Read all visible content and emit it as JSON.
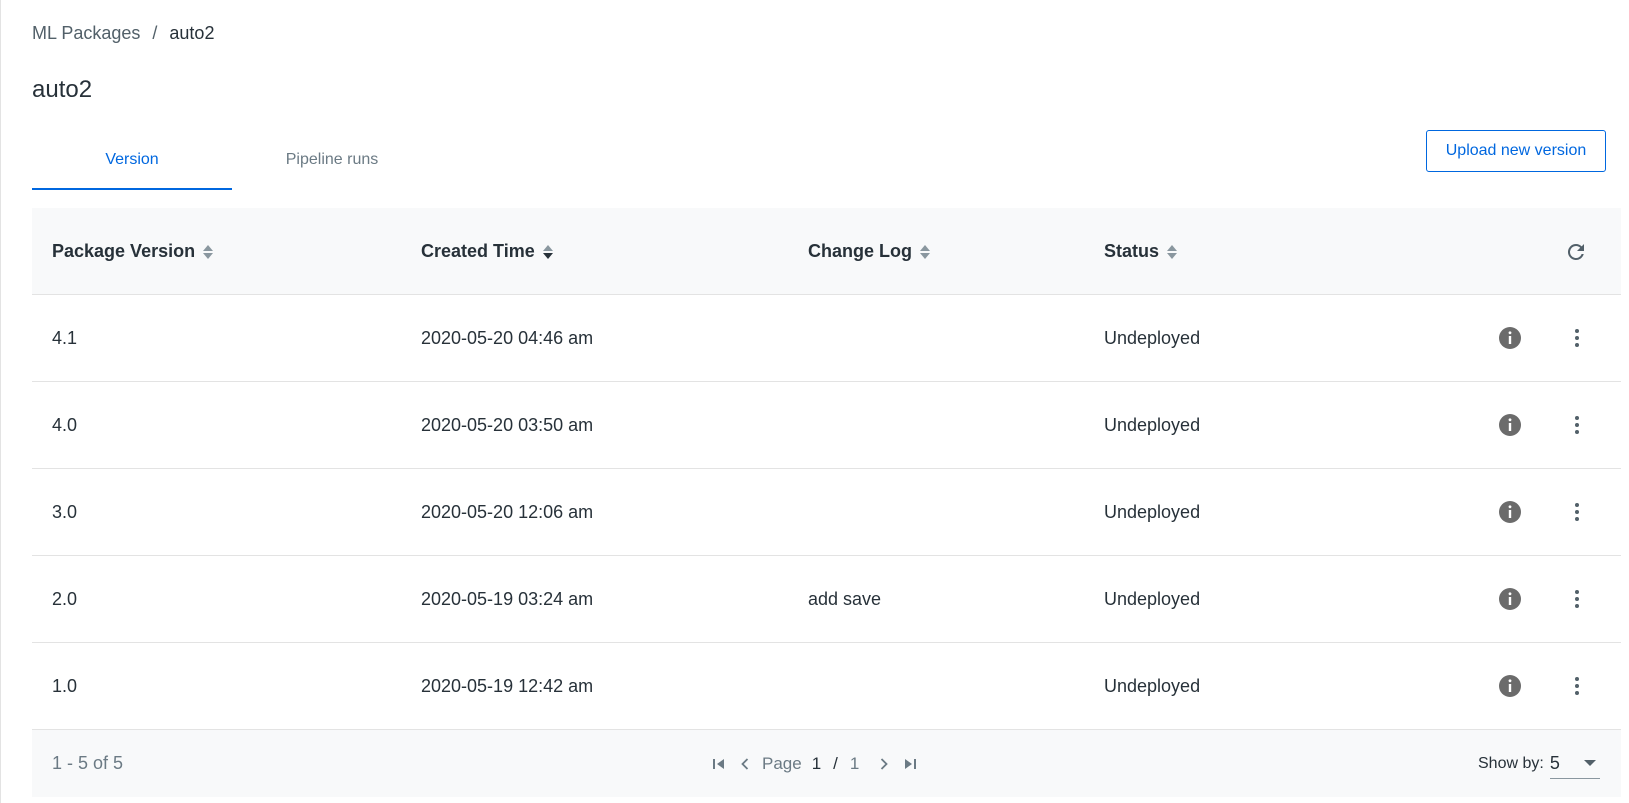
{
  "breadcrumb": {
    "parent": "ML Packages",
    "separator": "/",
    "current": "auto2"
  },
  "page_title": "auto2",
  "tabs": [
    {
      "label": "Version",
      "active": true
    },
    {
      "label": "Pipeline runs",
      "active": false
    }
  ],
  "upload_button": "Upload new version",
  "table": {
    "columns": [
      {
        "label": "Package Version"
      },
      {
        "label": "Created Time"
      },
      {
        "label": "Change Log"
      },
      {
        "label": "Status"
      }
    ],
    "rows": [
      {
        "version": "4.1",
        "created": "2020-05-20 04:46 am",
        "changelog": "",
        "status": "Undeployed"
      },
      {
        "version": "4.0",
        "created": "2020-05-20 03:50 am",
        "changelog": "",
        "status": "Undeployed"
      },
      {
        "version": "3.0",
        "created": "2020-05-20 12:06 am",
        "changelog": "",
        "status": "Undeployed"
      },
      {
        "version": "2.0",
        "created": "2020-05-19 03:24 am",
        "changelog": "add save",
        "status": "Undeployed"
      },
      {
        "version": "1.0",
        "created": "2020-05-19 12:42 am",
        "changelog": "",
        "status": "Undeployed"
      }
    ]
  },
  "footer": {
    "range": "1 - 5 of 5",
    "page_label": "Page",
    "current_page": "1",
    "page_separator": "/",
    "total_pages": "1",
    "show_by_label": "Show by:",
    "show_by_value": "5"
  },
  "icons": {
    "sort": "sort-icon",
    "refresh": "refresh-icon",
    "info": "info-icon",
    "more": "more-vertical-icon",
    "first": "first-page-icon",
    "prev": "prev-page-icon",
    "next": "next-page-icon",
    "last": "last-page-icon"
  },
  "colors": {
    "accent": "#0067df",
    "text": "#273139",
    "muted": "#6b7a84",
    "header_bg": "#f8f9fa",
    "icon": "#6b6b6b"
  }
}
